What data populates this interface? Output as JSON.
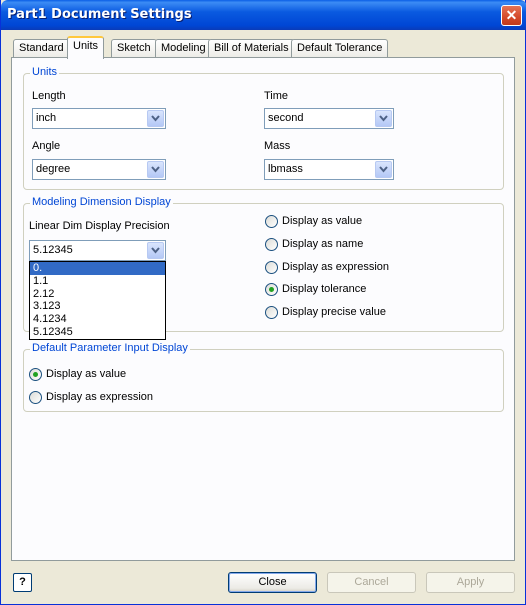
{
  "window": {
    "title": "Part1 Document Settings",
    "close_glyph": "✕"
  },
  "tabs": [
    {
      "label": "Standard"
    },
    {
      "label": "Units"
    },
    {
      "label": "Sketch"
    },
    {
      "label": "Modeling"
    },
    {
      "label": "Bill of Materials"
    },
    {
      "label": "Default Tolerance"
    }
  ],
  "active_tab": "Units",
  "units": {
    "title": "Units",
    "length": {
      "label": "Length",
      "value": "inch"
    },
    "time": {
      "label": "Time",
      "value": "second"
    },
    "angle": {
      "label": "Angle",
      "value": "degree"
    },
    "mass": {
      "label": "Mass",
      "value": "lbmass"
    }
  },
  "modeling_display": {
    "title": "Modeling Dimension Display",
    "precision_label": "Linear Dim Display Precision",
    "precision_value": "5.12345",
    "precision_options": [
      "0.",
      "1.1",
      "2.12",
      "3.123",
      "4.1234",
      "5.12345"
    ],
    "highlighted_option": "0.",
    "radios": [
      {
        "label": "Display as value",
        "checked": false
      },
      {
        "label": "Display as name",
        "checked": false
      },
      {
        "label": "Display as expression",
        "checked": false
      },
      {
        "label": "Display tolerance",
        "checked": true
      },
      {
        "label": "Display precise value",
        "checked": false
      }
    ]
  },
  "param_display": {
    "title": "Default Parameter Input Display",
    "radios": [
      {
        "label": "Display as value",
        "checked": true
      },
      {
        "label": "Display as expression",
        "checked": false
      }
    ]
  },
  "footer": {
    "help_glyph": "?",
    "close_label": "Close",
    "cancel_label": "Cancel",
    "apply_label": "Apply"
  },
  "colors": {
    "titlebar": "#0a5ae0",
    "group_title": "#0046d5",
    "selection": "#316ac5",
    "check": "#21a121"
  }
}
